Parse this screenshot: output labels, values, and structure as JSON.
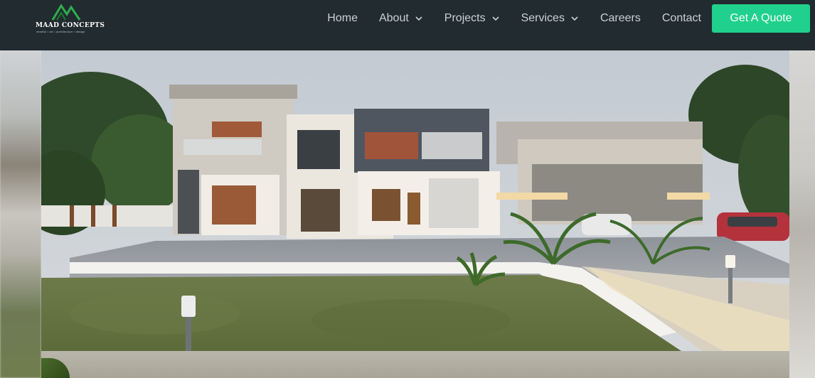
{
  "brand": {
    "name": "MAAD CONCEPTS",
    "tagline": "mindful • art • architecture • design",
    "accent_color": "#1fd18c",
    "navbar_color": "#222b2f"
  },
  "nav": {
    "items": [
      {
        "label": "Home",
        "has_dropdown": false
      },
      {
        "label": "About",
        "has_dropdown": true
      },
      {
        "label": "Projects",
        "has_dropdown": true
      },
      {
        "label": "Services",
        "has_dropdown": true
      },
      {
        "label": "Careers",
        "has_dropdown": false
      },
      {
        "label": "Contact",
        "has_dropdown": false
      }
    ],
    "cta_label": "Get A Quote"
  },
  "hero": {
    "image_subject": "modern-villa-photo"
  },
  "icons": {
    "dropdown": "chevron-down-icon",
    "logo": "mountain-logo-icon"
  }
}
